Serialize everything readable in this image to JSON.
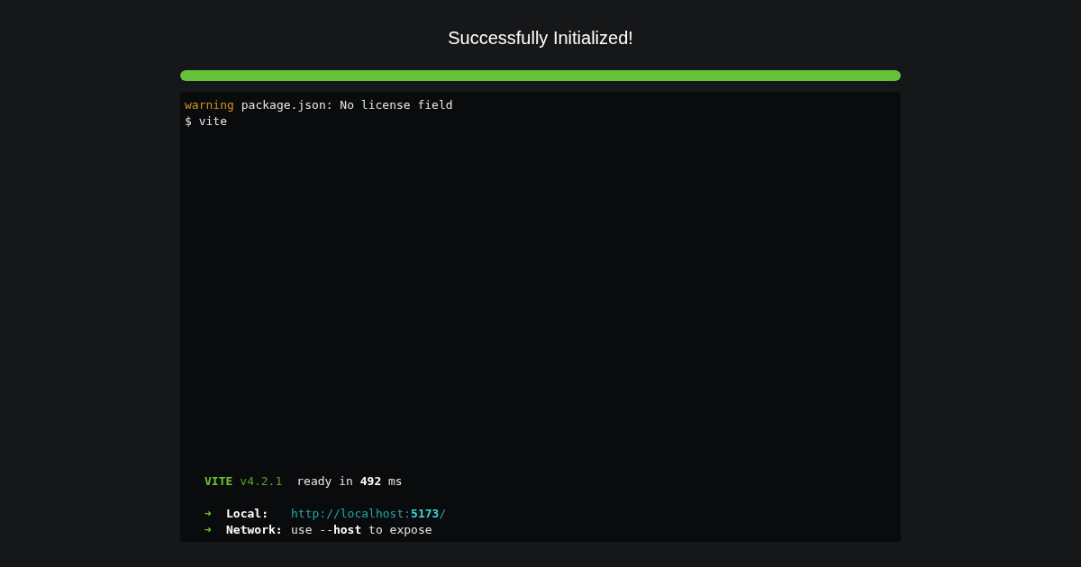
{
  "title": "Successfully Initialized!",
  "progress": {
    "level": 1
  },
  "terminal": {
    "warning": {
      "label": "warning",
      "message": "package.json: No license field"
    },
    "command": "$ vite",
    "server": {
      "name": "VITE",
      "version": "v4.2.1",
      "status": "ready in **492** ms"
    },
    "urls": [
      {
        "arrow": "➜",
        "label": "Local:",
        "value": "http://localhost:**5173**/"
      },
      {
        "arrow": "➜",
        "label": "Network:",
        "value": "use --**host** to expose"
      }
    ]
  }
}
